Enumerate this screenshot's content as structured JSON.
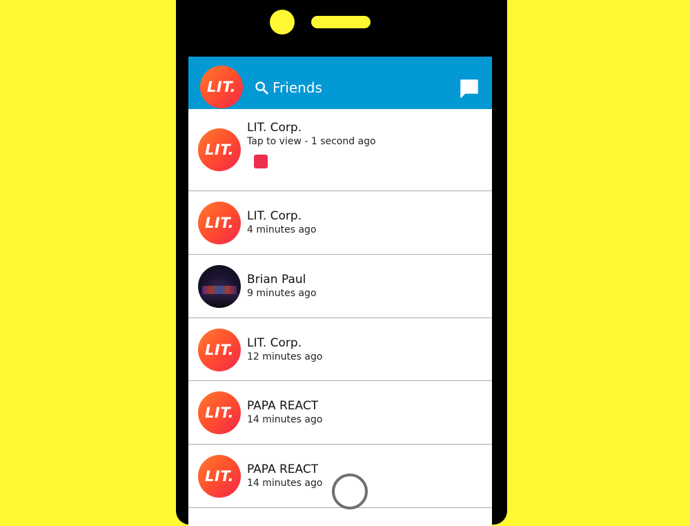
{
  "header": {
    "search_label": "Friends",
    "logo_text": "LIT."
  },
  "chats": [
    {
      "name": "LIT. Corp.",
      "status": "Tap to view - 1 second ago",
      "avatar": "lit-logo",
      "logo_text": "LIT.",
      "has_new_snap": true
    },
    {
      "name": "LIT. Corp.",
      "status": "4 minutes ago",
      "avatar": "lit-logo",
      "logo_text": "LIT."
    },
    {
      "name": "Brian Paul",
      "status": "9 minutes ago",
      "avatar": "photo"
    },
    {
      "name": "LIT. Corp.",
      "status": "12 minutes ago",
      "avatar": "lit-logo",
      "logo_text": "LIT."
    },
    {
      "name": "PAPA REACT",
      "status": "14 minutes ago",
      "avatar": "lit-logo",
      "logo_text": "LIT."
    },
    {
      "name": "PAPA REACT",
      "status": "14 minutes ago",
      "avatar": "lit-logo",
      "logo_text": "LIT."
    }
  ],
  "colors": {
    "background": "#FFF933",
    "header": "#0399D4",
    "snap_indicator": "#EE2E4F",
    "avatar_gradient_start": "#FF7A2E",
    "avatar_gradient_end": "#F4264A"
  }
}
